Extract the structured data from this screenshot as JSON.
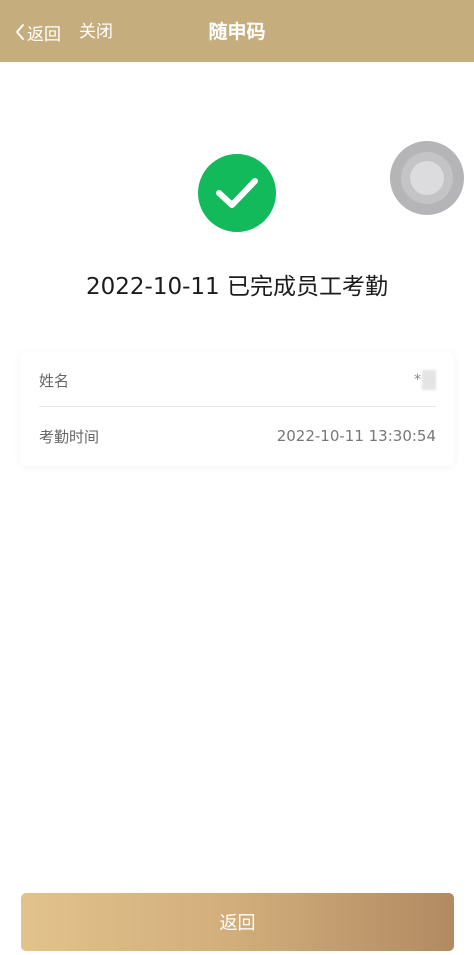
{
  "navbar": {
    "back_label": "返回",
    "close_label": "关闭",
    "title": "随申码",
    "background_color": "#c6ad7e"
  },
  "status": {
    "icon": "check-circle-icon",
    "icon_color": "#13ba5c",
    "message": "2022-10-11 已完成员工考勤"
  },
  "info": {
    "rows": [
      {
        "label": "姓名",
        "value": "*"
      },
      {
        "label": "考勤时间",
        "value": "2022-10-11 13:30:54"
      }
    ]
  },
  "floating_ball": {
    "icon": "assistive-touch-icon"
  },
  "footer": {
    "button_label": "返回"
  }
}
